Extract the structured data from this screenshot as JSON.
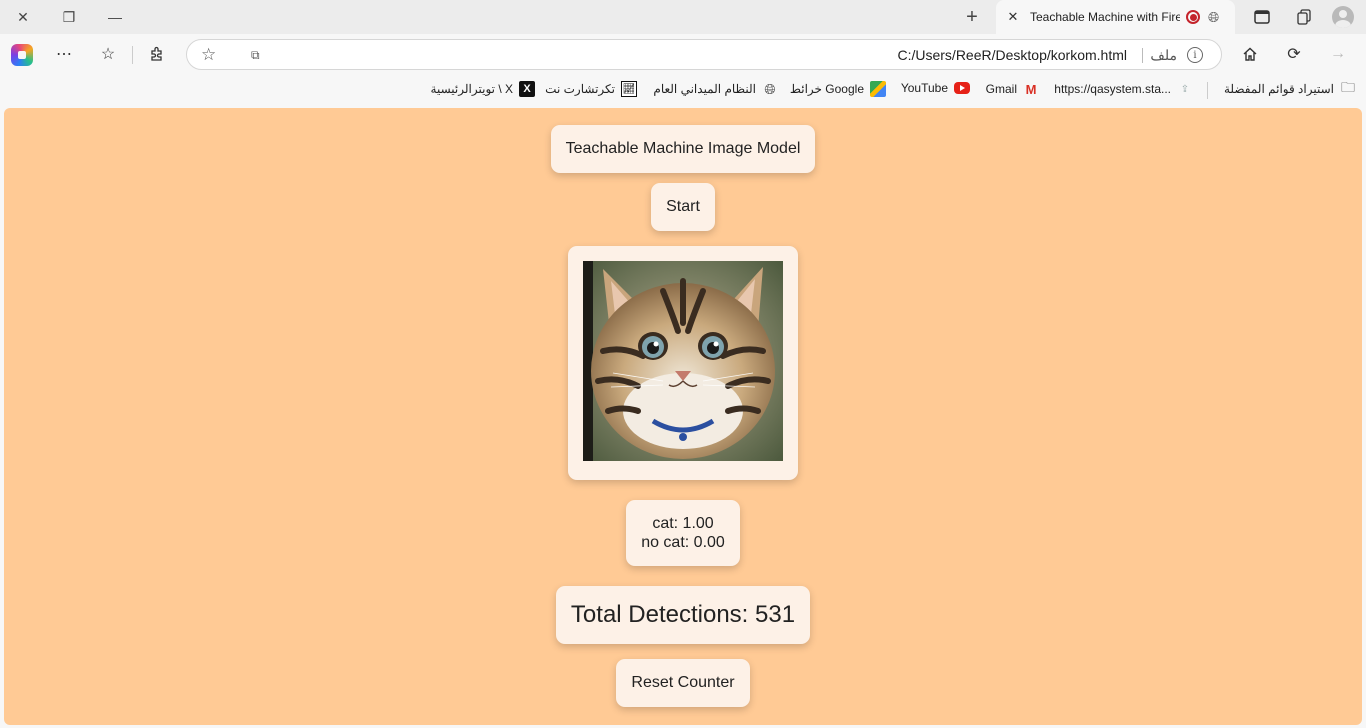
{
  "browser": {
    "tab_title": "Teachable Machine with Firebase",
    "address_url": "C:/Users/ReeR/Desktop/korkom.html",
    "address_scheme_label": "ملف",
    "info_icon": "i"
  },
  "bookmarks": [
    {
      "label": "استيراد قوائم المفضلة",
      "icon": "folder-import-icon"
    },
    {
      "label": "https://qasystem.sta...",
      "icon": "upload-icon"
    },
    {
      "label": "Gmail",
      "icon": "gmail-icon"
    },
    {
      "label": "YouTube",
      "icon": "youtube-icon"
    },
    {
      "label": "خرائط Google",
      "icon": "maps-icon"
    },
    {
      "label": "النظام الميداني العام",
      "icon": "globe-icon"
    },
    {
      "label": "تكرتشارت نت",
      "icon": "chart-icon"
    },
    {
      "label": "تويترالرئيسية \\ X",
      "icon": "x-icon"
    }
  ],
  "page": {
    "background": "#ffca95",
    "title_button": "Teachable Machine Image Model",
    "start_button": "Start",
    "predictions": [
      {
        "text": "cat: 1.00"
      },
      {
        "text": "no cat: 0.00"
      }
    ],
    "total_detections": "Total Detections: 531",
    "reset_button": "Reset Counter"
  }
}
